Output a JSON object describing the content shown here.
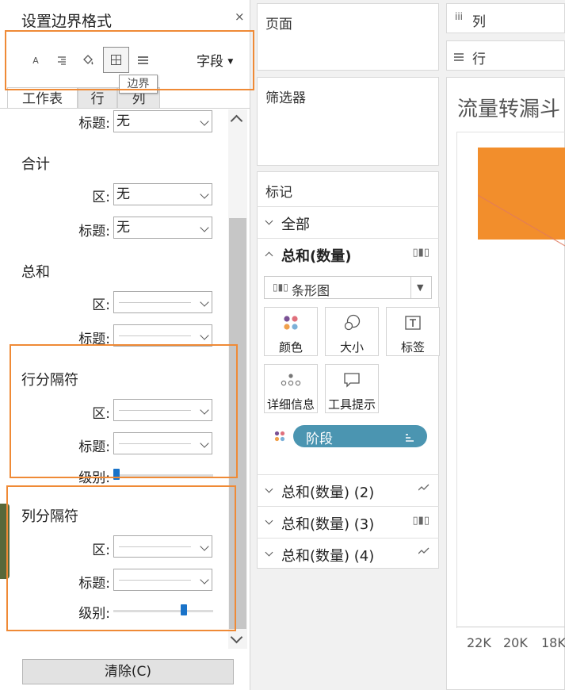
{
  "format_pane": {
    "title": "设置边界格式",
    "close": "×",
    "toolbar": {
      "font_btn": "A",
      "field_dropdown": "字段",
      "tooltip": "边界"
    },
    "tabs": [
      "工作表",
      "行",
      "列"
    ],
    "title_label": "标题:",
    "area_label": "区:",
    "level_label": "级别:",
    "top_title_value": "无",
    "sections": {
      "grand_total": {
        "name": "合计",
        "area": "无",
        "title": "无"
      },
      "total": {
        "name": "总和"
      },
      "row_divider": {
        "name": "行分隔符",
        "level": 0.0
      },
      "column_divider": {
        "name": "列分隔符",
        "level": 0.72
      }
    },
    "clear_button": "清除(C)"
  },
  "cards": {
    "pages": "页面",
    "filters": "筛选器",
    "marks": "标记"
  },
  "marks": {
    "all": "全部",
    "active_measure": "总和(数量)",
    "mark_type": "条形图",
    "buttons": [
      "颜色",
      "大小",
      "标签",
      "详细信息",
      "工具提示"
    ],
    "pill": "阶段",
    "other_measures": [
      "总和(数量) (2)",
      "总和(数量) (3)",
      "总和(数量) (4)"
    ]
  },
  "shelves": {
    "columns": "列",
    "rows": "行"
  },
  "view": {
    "title": "流量转漏斗",
    "axis_ticks": [
      "22K",
      "20K",
      "18K"
    ]
  },
  "colors": {
    "highlight": "#ef8a36",
    "bar": "#f28e2c",
    "pill": "#4b95b1",
    "accent": "#1a73c9"
  }
}
